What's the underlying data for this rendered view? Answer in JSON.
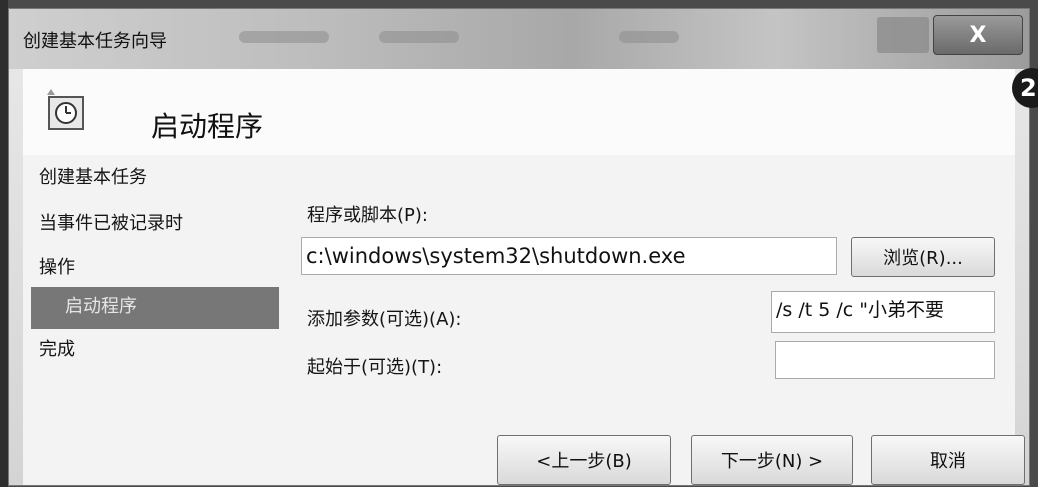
{
  "window": {
    "title": "创建基本任务向导",
    "close_label": "X"
  },
  "header": {
    "title": "启动程序"
  },
  "nav": {
    "items": [
      {
        "label": "创建基本任务"
      },
      {
        "label": "当事件已被记录时"
      },
      {
        "label": "操作"
      },
      {
        "label": "启动程序",
        "active": true
      },
      {
        "label": "完成"
      }
    ]
  },
  "form": {
    "program_label": "程序或脚本(P):",
    "program_value": "c:\\windows\\system32\\shutdown.exe",
    "browse_label": "浏览(R)...",
    "args_label": "添加参数(可选)(A):",
    "args_value": "/s /t 5 /c \"小弟不要",
    "start_in_label": "起始于(可选)(T):",
    "start_in_value": ""
  },
  "footer": {
    "back_label": "<上一步(B)",
    "next_label": "下一步(N) >",
    "cancel_label": "取消"
  },
  "callout": {
    "label": "2"
  },
  "icons": {
    "header": "scheduled-task-clock-icon"
  },
  "colors": {
    "active_nav_bg": "#777777",
    "dialog_bg": "#f3f3f3"
  }
}
